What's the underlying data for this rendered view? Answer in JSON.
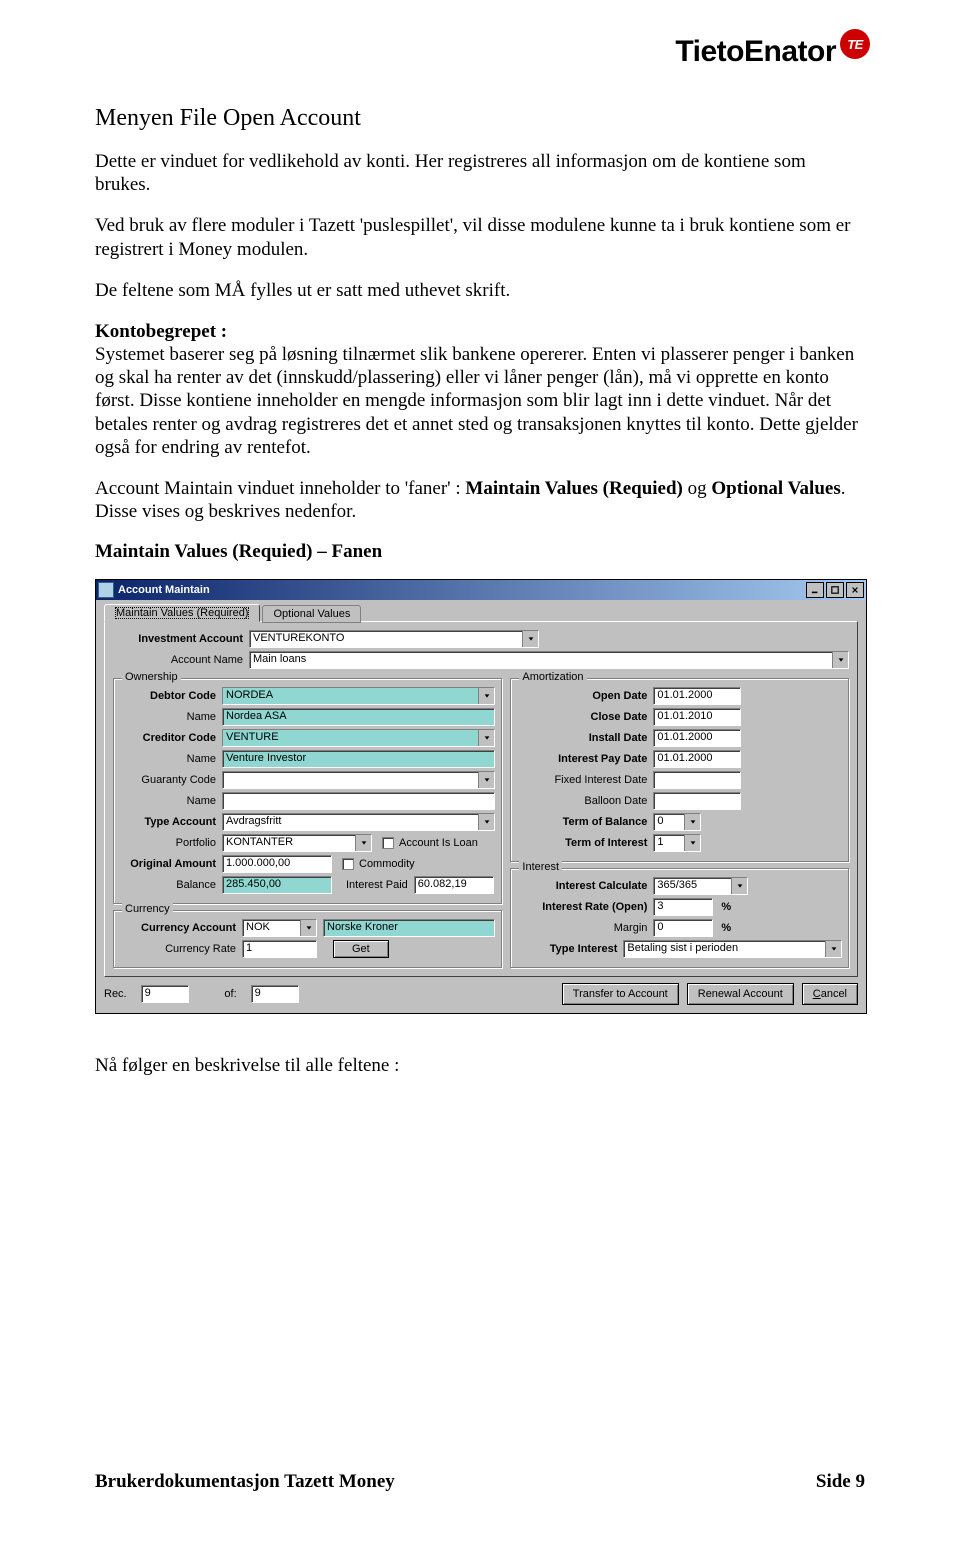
{
  "brand": {
    "name": "TietoEnator",
    "badge": "TE"
  },
  "doc": {
    "title": "Menyen File Open Account",
    "p1": "Dette er vinduet for vedlikehold av konti. Her registreres all informasjon om de kontiene som brukes.",
    "p2": "Ved bruk av flere moduler i Tazett 'puslespillet', vil disse modulene kunne ta i bruk kontiene som er registrert i Money modulen.",
    "p3": "De feltene som MÅ fylles ut er satt med uthevet skrift.",
    "konto_head": "Kontobegrepet :",
    "konto_body": "Systemet baserer seg på løsning tilnærmet slik bankene opererer. Enten vi plasserer penger i banken og skal ha renter av det (innskudd/plassering) eller vi låner penger (lån), må vi opprette en konto først. Disse kontiene inneholder en mengde informasjon som blir lagt inn i dette vinduet. Når det betales renter og avdrag registreres det et annet sted og transaksjonen knyttes til konto. Dette gjelder også for endring av rentefot.",
    "faner_pre": "Account Maintain vinduet inneholder to 'faner' : ",
    "faner_a": "Maintain Values (Requied)",
    "faner_mid": " og ",
    "faner_b": "Optional Values",
    "faner_post": ". Disse vises og beskrives nedenfor.",
    "tab_heading": "Maintain Values (Requied) – Fanen",
    "after": "Nå følger en beskrivelse til alle feltene :"
  },
  "win": {
    "title": "Account Maintain",
    "tabs": {
      "active": "Maintain Values (Required)",
      "inactive": "Optional Values"
    },
    "labels": {
      "inv_acct": "Investment Account",
      "acct_name": "Account Name",
      "ownership": "Ownership",
      "debtor_code": "Debtor Code",
      "debtor_name": "Name",
      "creditor_code": "Creditor Code",
      "creditor_name": "Name",
      "guaranty_code": "Guaranty Code",
      "guaranty_name": "Name",
      "type_acct": "Type Account",
      "portfolio": "Portfolio",
      "orig_amt": "Original Amount",
      "balance": "Balance",
      "acct_is_loan": "Account Is Loan",
      "commodity": "Commodity",
      "interest_paid": "Interest Paid",
      "currency": "Currency",
      "curr_acct": "Currency Account",
      "curr_rate": "Currency Rate",
      "get": "Get",
      "amort": "Amortization",
      "open_date": "Open Date",
      "close_date": "Close Date",
      "install_date": "Install Date",
      "int_pay_date": "Interest Pay Date",
      "fixed_int_date": "Fixed Interest Date",
      "balloon_date": "Balloon Date",
      "term_balance": "Term of Balance",
      "term_interest": "Term of Interest",
      "interest": "Interest",
      "int_calc": "Interest Calculate",
      "int_rate_open": "Interest Rate (Open)",
      "margin": "Margin",
      "type_interest": "Type Interest",
      "pct": "%"
    },
    "vals": {
      "inv_acct": "VENTUREKONTO",
      "acct_name": "Main loans",
      "debtor_code": "NORDEA",
      "debtor_name": "Nordea ASA",
      "creditor_code": "VENTURE",
      "creditor_name": "Venture Investor",
      "guaranty_code": "",
      "guaranty_name": "",
      "type_acct": "Avdragsfritt",
      "portfolio": "KONTANTER",
      "orig_amt": "1.000.000,00",
      "balance": "285.450,00",
      "interest_paid": "60.082,19",
      "curr_acct": "NOK",
      "curr_name": "Norske Kroner",
      "curr_rate": "1",
      "open_date": "01.01.2000",
      "close_date": "01.01.2010",
      "install_date": "01.01.2000",
      "int_pay_date": "01.01.2000",
      "fixed_int_date": "",
      "balloon_date": "",
      "term_balance": "0",
      "term_interest": "1",
      "int_calc": "365/365",
      "int_rate_open": "3",
      "margin": "0",
      "type_interest": "Betaling sist i perioden"
    },
    "footer": {
      "rec_lbl": "Rec.",
      "rec_val": "9",
      "of_lbl": "of:",
      "of_val": "9",
      "transfer": "Transfer to Account",
      "renewal": "Renewal Account",
      "cancel_pre": "",
      "cancel_key": "C",
      "cancel_post": "ancel"
    }
  },
  "pagefoot": {
    "left": "Brukerdokumentasjon Tazett Money",
    "right": "Side 9"
  }
}
